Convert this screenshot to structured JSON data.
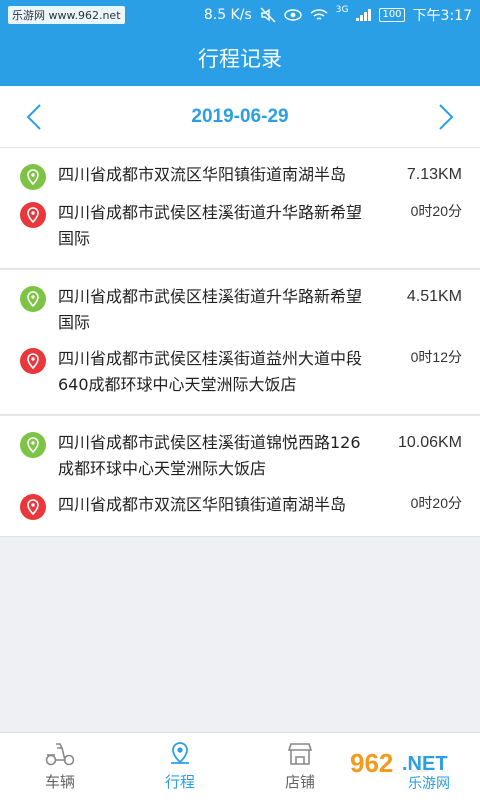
{
  "statusbar": {
    "watermark": "乐游网 www.962.net",
    "network_speed": "8.5 K/s",
    "network_type": "3G",
    "battery": "100",
    "time": "下午3:17"
  },
  "header": {
    "title": "行程记录"
  },
  "datebar": {
    "date": "2019-06-29"
  },
  "trips": [
    {
      "start": "四川省成都市双流区华阳镇街道南湖半岛",
      "end": "四川省成都市武侯区桂溪街道升华路新希望国际",
      "distance": "7.13KM",
      "duration": "0时20分"
    },
    {
      "start": "四川省成都市武侯区桂溪街道升华路新希望国际",
      "end": "四川省成都市武侯区桂溪街道益州大道中段640成都环球中心天堂洲际大饭店",
      "distance": "4.51KM",
      "duration": "0时12分"
    },
    {
      "start": "四川省成都市武侯区桂溪街道锦悦西路126成都环球中心天堂洲际大饭店",
      "end": "四川省成都市双流区华阳镇街道南湖半岛",
      "distance": "10.06KM",
      "duration": "0时20分"
    }
  ],
  "tabbar": {
    "tabs": [
      {
        "label": "车辆",
        "icon": "scooter-icon"
      },
      {
        "label": "行程",
        "icon": "location-pin-icon"
      },
      {
        "label": "店铺",
        "icon": "store-icon"
      },
      {
        "label": "",
        "icon": "menu-icon"
      }
    ],
    "active_index": 1
  },
  "watermark_bottom": "962.NET 乐游网",
  "colors": {
    "primary": "#2a9fe6",
    "start_pin": "#7dc346",
    "end_pin": "#e8383b"
  }
}
